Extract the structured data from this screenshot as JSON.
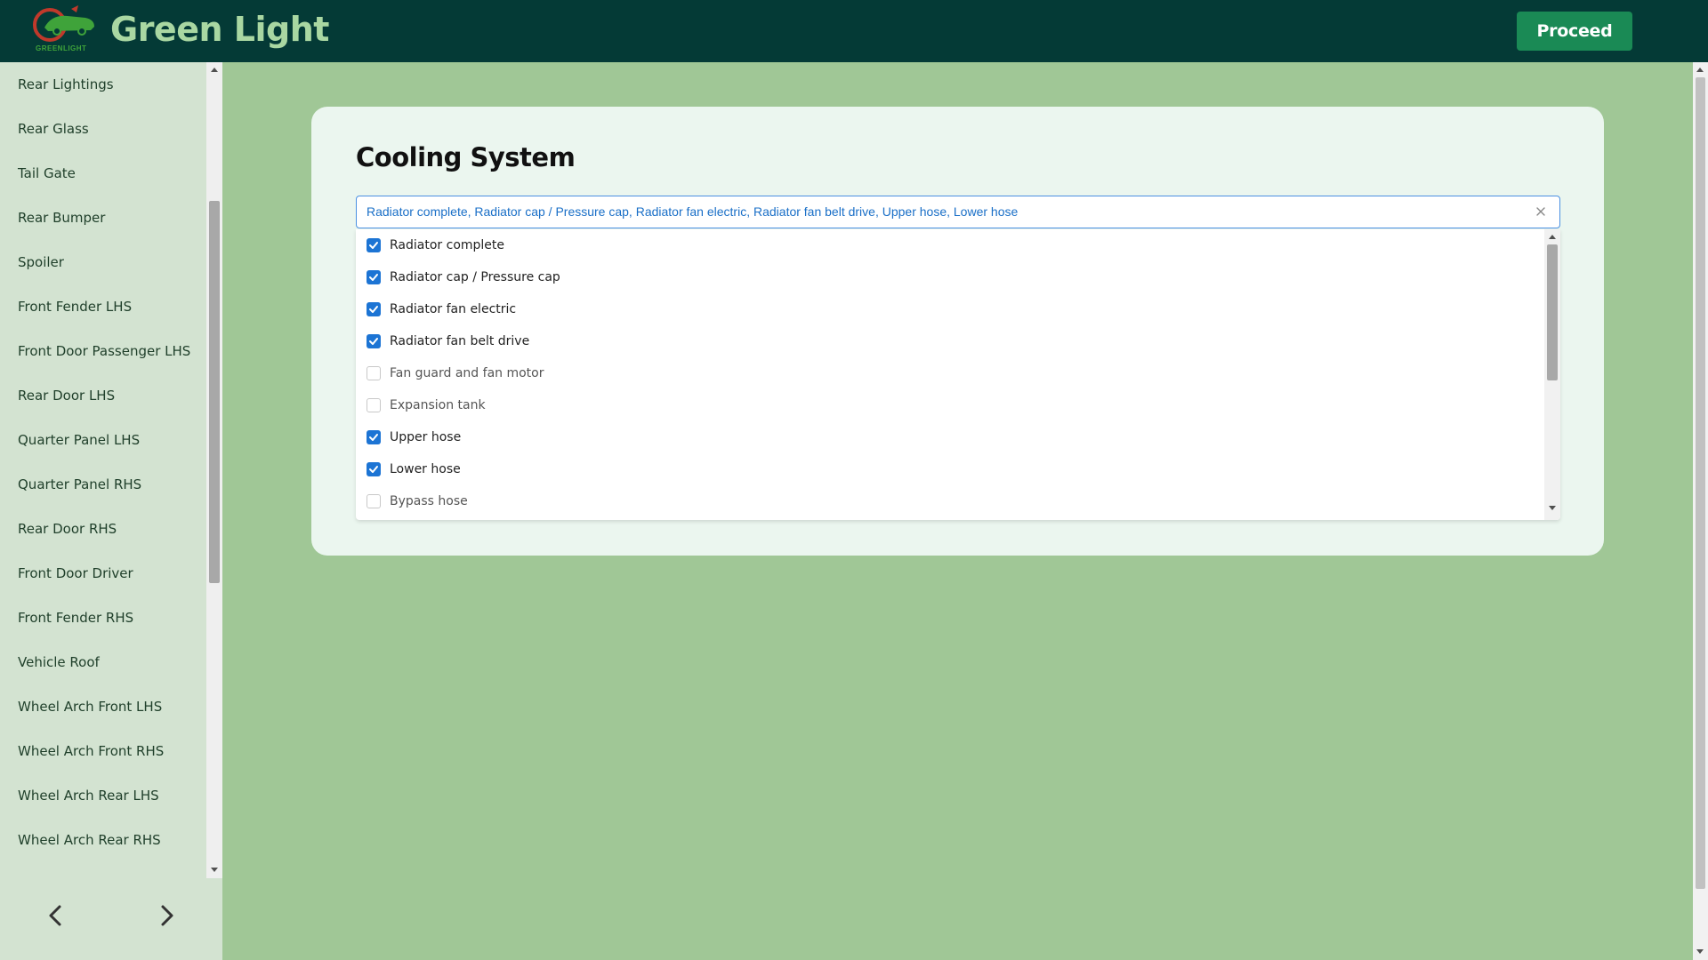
{
  "header": {
    "app_title": "Green Light",
    "logo_text": "GREENLIGHT",
    "proceed_label": "Proceed"
  },
  "colors": {
    "header_bg": "#043a36",
    "page_bg": "#a0c796",
    "sidebar_bg": "#d3e3d1",
    "card_bg": "#ebf6ef",
    "accent": "#1a8a55",
    "checkbox_checked": "#1c74d4"
  },
  "sidebar": {
    "items": [
      {
        "label": "Rear Lightings"
      },
      {
        "label": "Rear Glass"
      },
      {
        "label": "Tail Gate"
      },
      {
        "label": "Rear Bumper"
      },
      {
        "label": "Spoiler"
      },
      {
        "label": "Front Fender LHS"
      },
      {
        "label": "Front Door Passenger LHS"
      },
      {
        "label": "Rear Door LHS"
      },
      {
        "label": "Quarter Panel LHS"
      },
      {
        "label": "Quarter Panel RHS"
      },
      {
        "label": "Rear Door RHS"
      },
      {
        "label": "Front Door Driver"
      },
      {
        "label": "Front Fender RHS"
      },
      {
        "label": "Vehicle Roof"
      },
      {
        "label": "Wheel Arch Front LHS"
      },
      {
        "label": "Wheel Arch Front RHS"
      },
      {
        "label": "Wheel Arch Rear LHS"
      },
      {
        "label": "Wheel Arch Rear RHS"
      }
    ],
    "prev_icon": "chevron-left-icon",
    "next_icon": "chevron-right-icon"
  },
  "main": {
    "section_title": "Cooling System",
    "select_value": "Radiator complete, Radiator cap / Pressure cap, Radiator fan electric, Radiator fan belt drive, Upper hose, Lower hose",
    "clear_icon": "close-icon",
    "options": [
      {
        "label": "Radiator complete",
        "checked": true
      },
      {
        "label": "Radiator cap / Pressure cap",
        "checked": true
      },
      {
        "label": "Radiator fan electric",
        "checked": true
      },
      {
        "label": "Radiator fan belt drive",
        "checked": true
      },
      {
        "label": "Fan guard and fan motor",
        "checked": false
      },
      {
        "label": "Expansion tank",
        "checked": false
      },
      {
        "label": "Upper hose",
        "checked": true
      },
      {
        "label": "Lower hose",
        "checked": true
      },
      {
        "label": "Bypass hose",
        "checked": false
      }
    ]
  }
}
